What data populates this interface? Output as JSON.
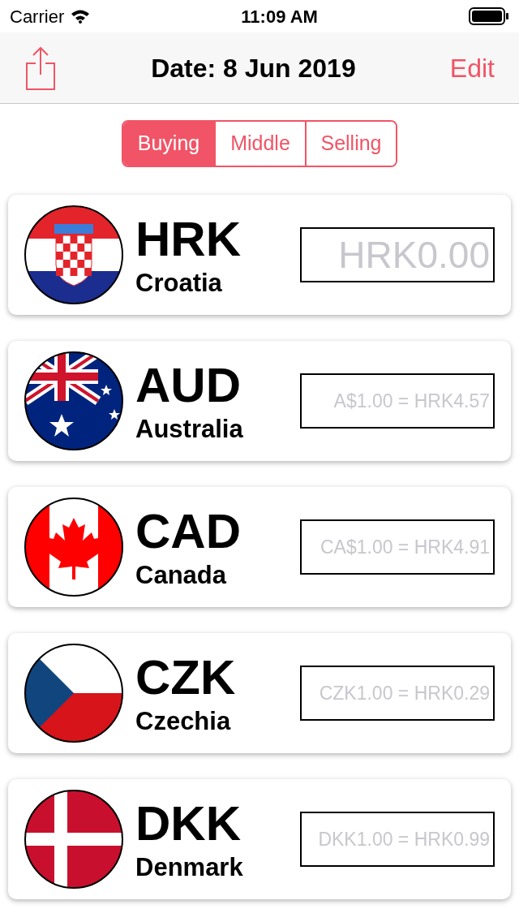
{
  "status_bar": {
    "carrier": "Carrier",
    "time": "11:09 AM"
  },
  "nav": {
    "title": "Date: 8 Jun 2019",
    "edit": "Edit"
  },
  "segments": [
    {
      "label": "Buying",
      "selected": true
    },
    {
      "label": "Middle",
      "selected": false
    },
    {
      "label": "Selling",
      "selected": false
    }
  ],
  "currencies": [
    {
      "code": "HRK",
      "country": "Croatia",
      "kind": "croatia",
      "base": true,
      "placeholder": "HRK0.00"
    },
    {
      "code": "AUD",
      "country": "Australia",
      "kind": "australia",
      "base": false,
      "placeholder": "A$1.00 = HRK4.57"
    },
    {
      "code": "CAD",
      "country": "Canada",
      "kind": "canada",
      "base": false,
      "placeholder": "CA$1.00 = HRK4.91"
    },
    {
      "code": "CZK",
      "country": "Czechia",
      "kind": "czechia",
      "base": false,
      "placeholder": "CZK1.00 = HRK0.29"
    },
    {
      "code": "DKK",
      "country": "Denmark",
      "kind": "denmark",
      "base": false,
      "placeholder": "DKK1.00 = HRK0.99"
    }
  ]
}
